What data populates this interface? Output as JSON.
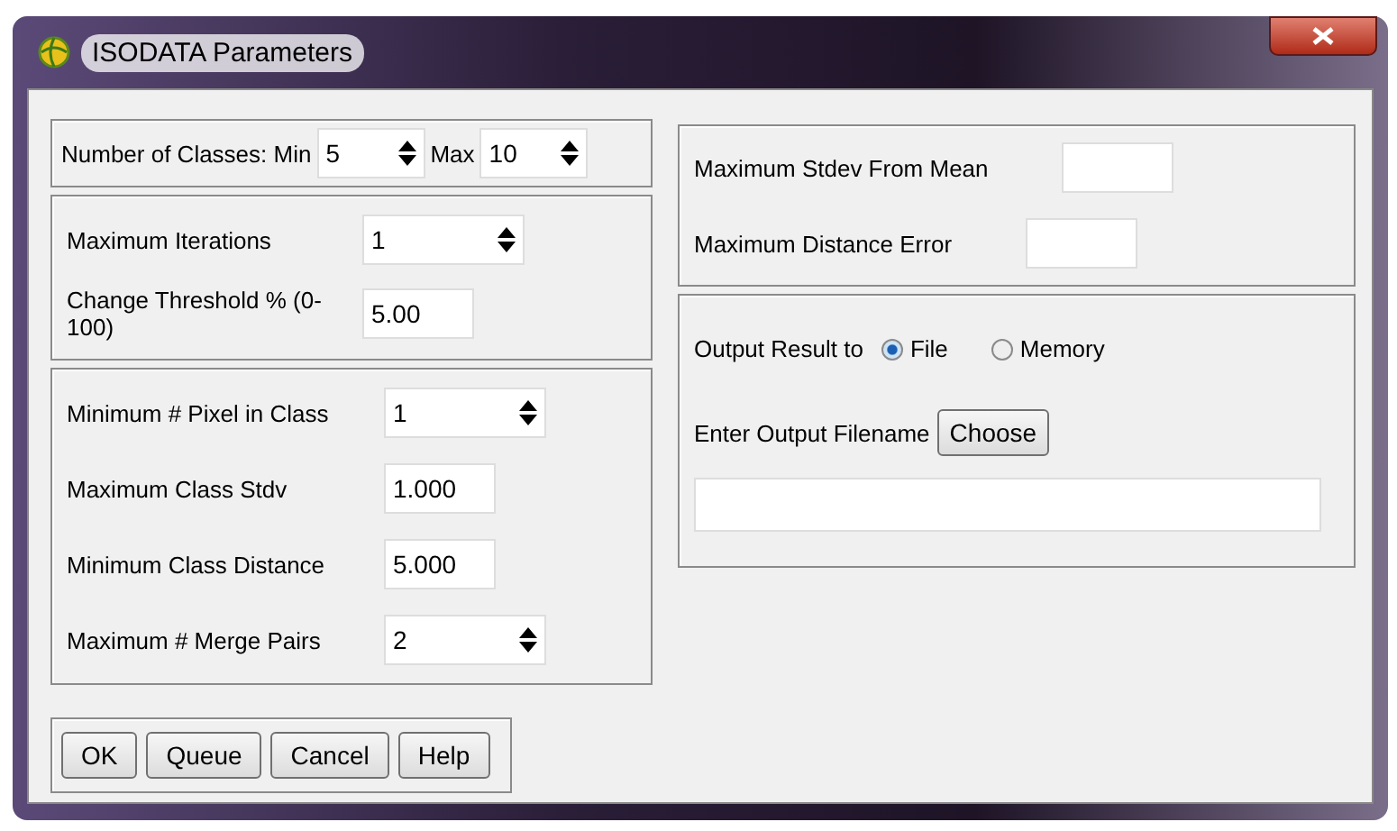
{
  "window": {
    "title": "ISODATA Parameters"
  },
  "classes": {
    "label": "Number of Classes: Min",
    "min": "5",
    "max_label": "Max",
    "max": "10"
  },
  "groups": [
    {
      "rows": [
        {
          "label": "Maximum Iterations",
          "kind": "spinner",
          "value": "1"
        },
        {
          "label": "Change Threshold % (0-100)",
          "kind": "text",
          "value": "5.00"
        }
      ]
    },
    {
      "rows": [
        {
          "label": "Minimum # Pixel in Class",
          "kind": "spinner",
          "value": "1"
        },
        {
          "label": "Maximum Class Stdv",
          "kind": "text",
          "value": "1.000"
        },
        {
          "label": "Minimum Class Distance",
          "kind": "text",
          "value": "5.000"
        },
        {
          "label": "Maximum # Merge Pairs",
          "kind": "spinner",
          "value": "2"
        }
      ]
    }
  ],
  "buttons": [
    "OK",
    "Queue",
    "Cancel",
    "Help"
  ],
  "right_rows": [
    {
      "label": "Maximum Stdev From Mean",
      "kind": "text"
    },
    {
      "label": "Maximum Distance Error",
      "kind": "text"
    }
  ],
  "output": {
    "label": "Output Result to",
    "options": [
      {
        "label": "File",
        "selected": true
      },
      {
        "label": "Memory",
        "selected": false
      }
    ],
    "filename_label": "Enter Output Filename",
    "choose": "Choose"
  }
}
